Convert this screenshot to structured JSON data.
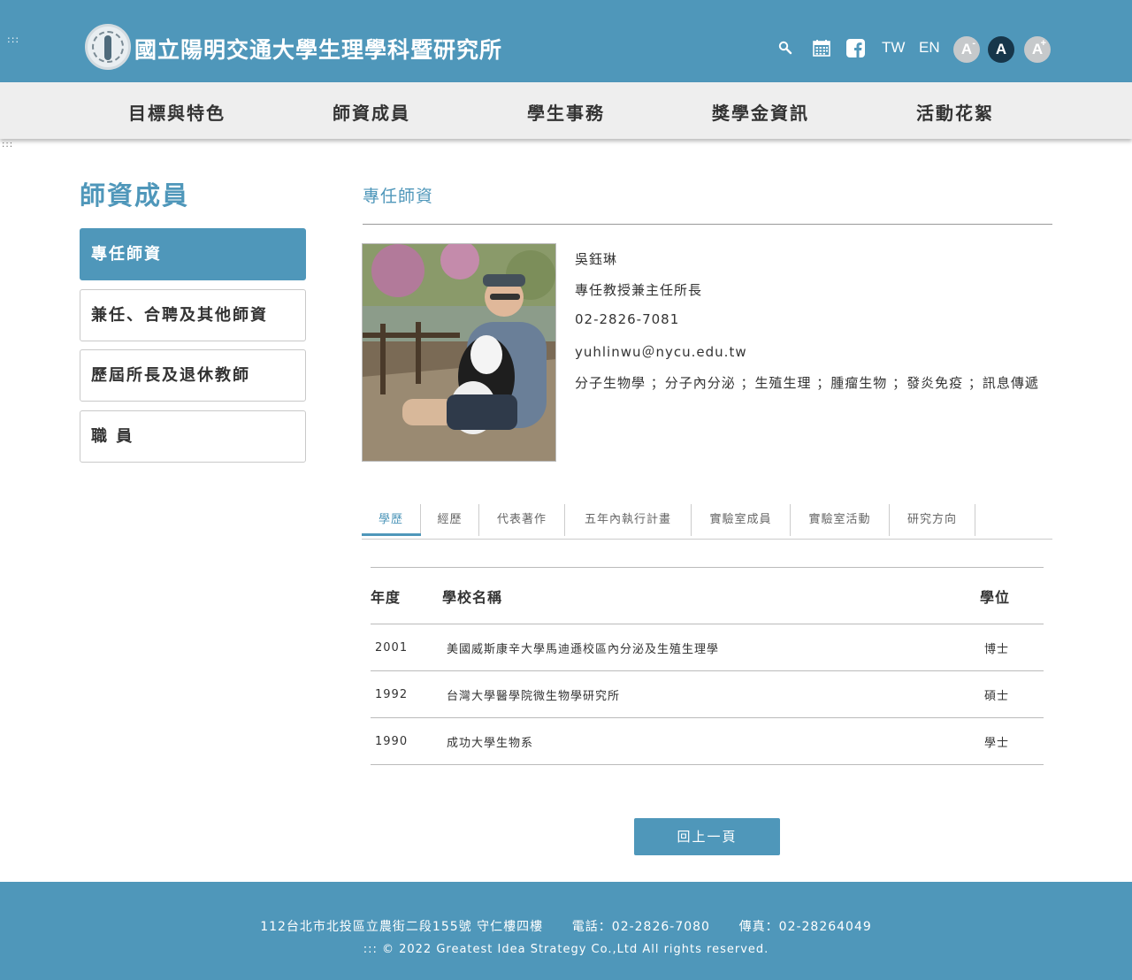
{
  "header": {
    "accesskey_top": ":::",
    "site_title": "國立陽明交通大學生理學科暨研究所",
    "icons": [
      "search-icon",
      "calendar-icon",
      "facebook-icon"
    ],
    "lang_tw": "TW",
    "lang_en": "EN",
    "font_small": "A",
    "font_small_mark": "-",
    "font_mid": "A",
    "font_large": "A",
    "font_large_mark": "+"
  },
  "nav": {
    "items": [
      "目標與特色",
      "師資成員",
      "學生事務",
      "獎學金資訊",
      "活動花絮"
    ]
  },
  "accesskey_center": ":::",
  "sidebar": {
    "title": "師資成員",
    "items": [
      "專任師資",
      "兼任、合聘及其他師資",
      "歷屆所長及退休教師",
      "職 員"
    ]
  },
  "main": {
    "section_title": "專任師資",
    "profile": {
      "name": "吳鈺琳",
      "position": "專任教授兼主任所長",
      "phone": "02-2826-7081",
      "email": "yuhlinwu＠nycu.edu.tw",
      "research": "分子生物學 ；分子內分泌 ；生殖生理 ；腫瘤生物 ；發炎免疫 ；訊息傳遞"
    },
    "tabs": [
      "學歷",
      "經歷",
      "代表著作",
      "五年內執行計畫",
      "實驗室成員",
      "實驗室活動",
      "研究方向"
    ],
    "education": {
      "headers": [
        "年度",
        "學校名稱",
        "學位"
      ],
      "rows": [
        [
          "2001",
          "美國威斯康辛大學馬迪遜校區內分泌及生殖生理學",
          "博士"
        ],
        [
          "1992",
          "台灣大學醫學院微生物學研究所",
          "碩士"
        ],
        [
          "1990",
          "成功大學生物系",
          "學士"
        ]
      ]
    },
    "back_label": "回上一頁"
  },
  "footer": {
    "line1": "112台北市北投區立農街二段155號 守仁樓四樓      電話：02-2826-7080      傳真：02-28264049",
    "line2": "::: © 2022 Greatest Idea Strategy Co.,Ltd All rights reserved."
  },
  "colors": {
    "brand": "#4f97ba",
    "nav_bg": "#eeeeee",
    "font_active": "#17364a"
  }
}
